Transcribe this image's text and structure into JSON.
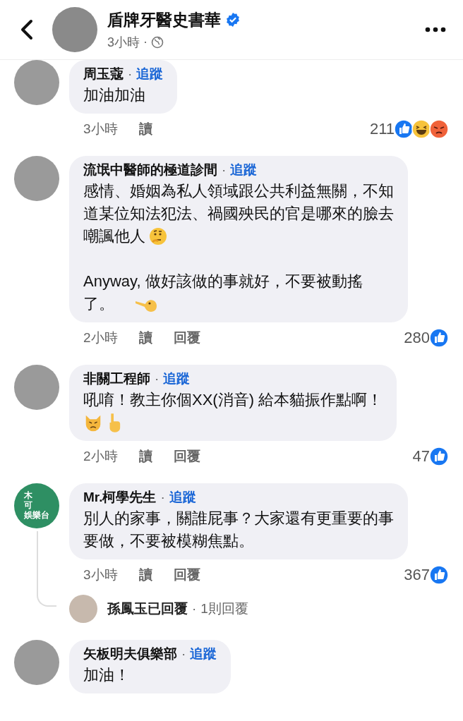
{
  "header": {
    "page_name": "盾牌牙醫史書華",
    "verified": true,
    "time": "3小時",
    "separator": "·"
  },
  "comments": [
    {
      "author": "周玉蔻",
      "separator": "·",
      "follow": "追蹤",
      "paragraphs": [
        [
          {
            "text": "加油加油"
          }
        ]
      ],
      "time": "3小時",
      "actions": [
        "讀"
      ],
      "reaction_count": "211",
      "reactions": [
        {
          "kind": "like"
        },
        {
          "kind": "haha"
        },
        {
          "kind": "angry"
        }
      ]
    },
    {
      "author": "流氓中醫師的極道診間",
      "separator": "·",
      "follow": "追蹤",
      "paragraphs": [
        [
          {
            "text": "感情、婚姻為私人領域跟公共利益無關，不知"
          },
          {
            "text": "道某位知法犯法、禍國殃民的官是哪來的臉去"
          },
          {
            "text": "嘲諷他人",
            "emojis": [
              {
                "kind": "thinking"
              }
            ]
          }
        ],
        [
          {
            "text": "Anyway, 做好該做的事就好，不要被動搖"
          },
          {
            "text": "了。",
            "emojis": [
              {
                "kind": "pointing"
              }
            ]
          }
        ]
      ],
      "time": "2小時",
      "actions": [
        "讀",
        "回覆"
      ],
      "reaction_count": "280",
      "reactions": [
        {
          "kind": "like"
        }
      ]
    },
    {
      "author": "非關工程師",
      "separator": "·",
      "follow": "追蹤",
      "paragraphs": [
        [
          {
            "text": "吼唷！教主你個XX(消音) 給本貓振作點啊！"
          },
          {
            "emojis": [
              {
                "kind": "cat"
              },
              {
                "kind": "finger-up"
              }
            ]
          }
        ]
      ],
      "time": "2小時",
      "actions": [
        "讀",
        "回覆"
      ],
      "reaction_count": "47",
      "reactions": [
        {
          "kind": "like"
        }
      ]
    },
    {
      "author": "Mr.柯學先生",
      "separator": "·",
      "follow": "追蹤",
      "paragraphs": [
        [
          {
            "text": "別人的家事，關誰屁事？大家還有更重要的事"
          },
          {
            "text": "要做，不要被模糊焦點。"
          }
        ]
      ],
      "time": "3小時",
      "actions": [
        "讀",
        "回覆"
      ],
      "reaction_count": "367",
      "reactions": [
        {
          "kind": "like"
        }
      ],
      "avatar": {
        "kind": "logo",
        "texts": [
          "木",
          "可",
          "娛樂台"
        ]
      },
      "reply_summary": {
        "text": "孫鳳玉已回覆",
        "separator": "·",
        "count": "1則回覆"
      }
    },
    {
      "author": "矢板明夫俱樂部",
      "separator": "·",
      "follow": "追蹤",
      "paragraphs": [
        [
          {
            "text": "加油！"
          }
        ]
      ]
    }
  ]
}
